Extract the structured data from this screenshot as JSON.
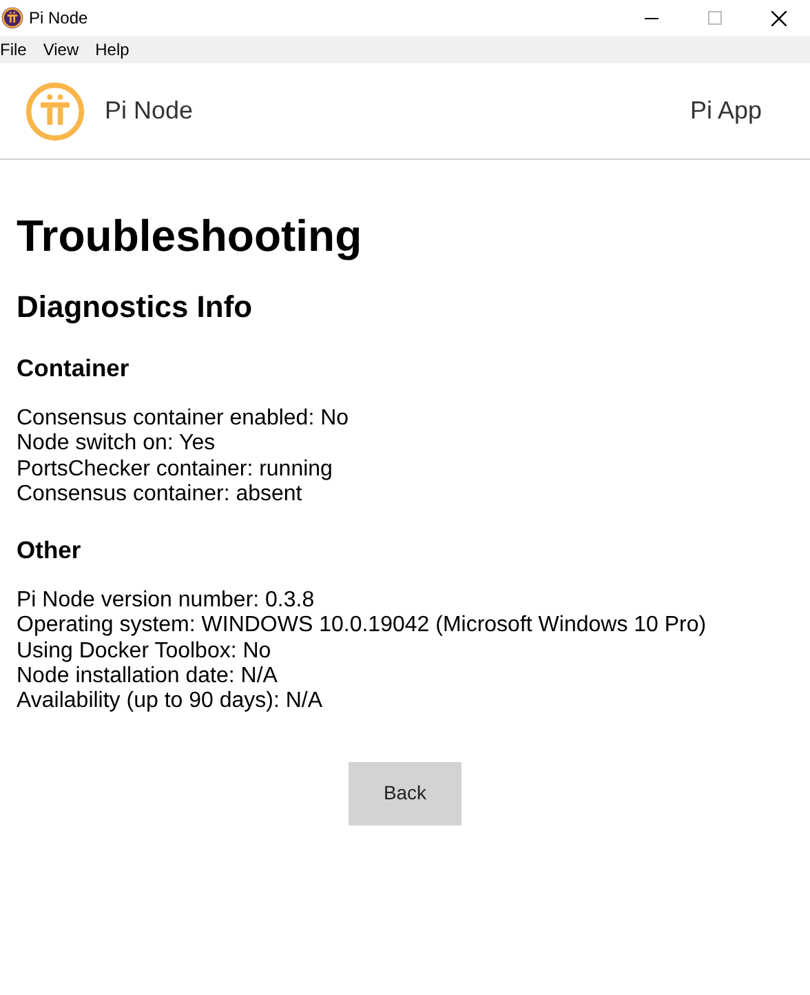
{
  "window": {
    "title": "Pi Node"
  },
  "menu": [
    "File",
    "View",
    "Help"
  ],
  "header": {
    "app_name": "Pi Node",
    "link": "Pi App"
  },
  "page_title": "Troubleshooting",
  "section_title": "Diagnostics Info",
  "groups": [
    {
      "title": "Container",
      "lines": [
        "Consensus container enabled: No",
        "Node switch on: Yes",
        "PortsChecker container: running",
        "Consensus container: absent"
      ]
    },
    {
      "title": "Other",
      "lines": [
        "Pi Node version number: 0.3.8",
        "Operating system: WINDOWS 10.0.19042 (Microsoft Windows 10 Pro)",
        "Using Docker Toolbox: No",
        "Node installation date: N/A",
        "Availability (up to 90 days): N/A"
      ]
    }
  ],
  "button": "Back"
}
